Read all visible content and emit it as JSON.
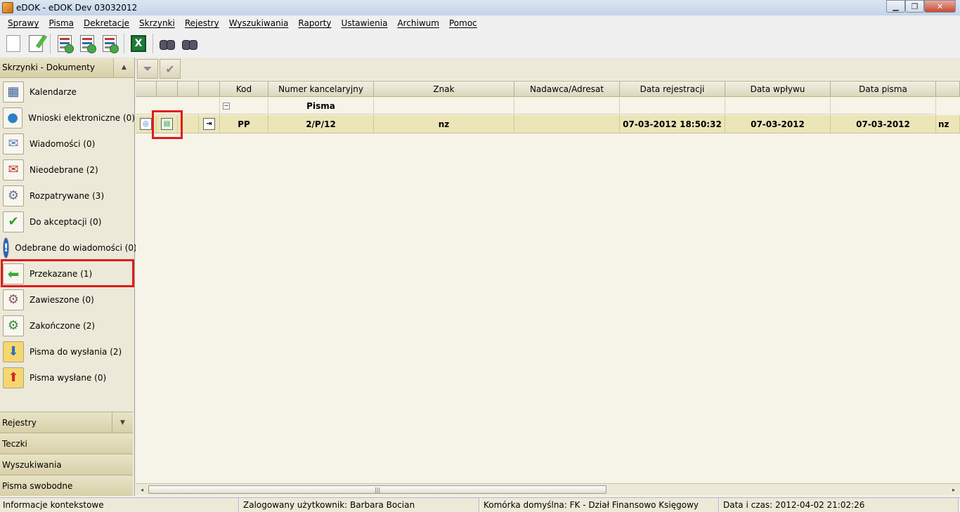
{
  "window": {
    "title": "eDOK - eDOK Dev 03032012"
  },
  "menu": [
    "Sprawy",
    "Pisma",
    "Dekretacje",
    "Skrzynki",
    "Rejestry",
    "Wyszukiwania",
    "Raporty",
    "Ustawienia",
    "Archiwum",
    "Pomoc"
  ],
  "toolbar": {
    "buttons": [
      "new-document-icon",
      "edit-document-icon",
      "refresh-register-icon",
      "refresh-register-2-icon",
      "refresh-register-3-icon",
      "excel-export-icon",
      "search-binoculars-icon",
      "search-folder-icon"
    ]
  },
  "left_panel": {
    "header": "Skrzynki - Dokumenty",
    "items": [
      {
        "label": "Kalendarze",
        "icon": "calendar-icon"
      },
      {
        "label": "Wnioski elektroniczne (0)",
        "icon": "globe-icon"
      },
      {
        "label": "Wiadomości (0)",
        "icon": "messages-icon"
      },
      {
        "label": "Nieodebrane (2)",
        "icon": "mailbox-icon"
      },
      {
        "label": "Rozpatrywane (3)",
        "icon": "gear-icon"
      },
      {
        "label": "Do akceptacji (0)",
        "icon": "checkmark-icon"
      },
      {
        "label": "Odebrane do wiadomości (0)",
        "icon": "info-icon"
      },
      {
        "label": "Przekazane (1)",
        "icon": "arrow-left-icon"
      },
      {
        "label": "Zawieszone (0)",
        "icon": "gear-paused-icon"
      },
      {
        "label": "Zakończone (2)",
        "icon": "gear-done-icon"
      },
      {
        "label": "Pisma do wysłania (2)",
        "icon": "outbox-icon"
      },
      {
        "label": "Pisma wysłane (0)",
        "icon": "sent-icon"
      }
    ],
    "footer": [
      "Rejestry",
      "Teczki",
      "Wyszukiwania",
      "Pisma swobodne"
    ]
  },
  "grid": {
    "columns": [
      "",
      "",
      "",
      "",
      "Kod",
      "Numer kancelaryjny",
      "Znak",
      "Nadawca/Adresat",
      "Data rejestracji",
      "Data wpływu",
      "Data pisma",
      ""
    ],
    "group_label": "Pisma",
    "group_expander": "−",
    "rows": [
      {
        "kod": "PP",
        "numer": "2/P/12",
        "znak": "nz",
        "nadawca": "",
        "data_rejestracji": "07-03-2012 18:50:32",
        "data_wplywu": "07-03-2012",
        "data_pisma": "07-03-2012",
        "extra": "nz"
      }
    ]
  },
  "status": {
    "info": "Informacje kontekstowe",
    "user": "Zalogowany użytkownik: Barbara Bocian",
    "cell": "Komórka domyślna: FK - Dział Finansowo Księgowy",
    "datetime": "Data i czas: 2012-04-02 21:02:26"
  }
}
